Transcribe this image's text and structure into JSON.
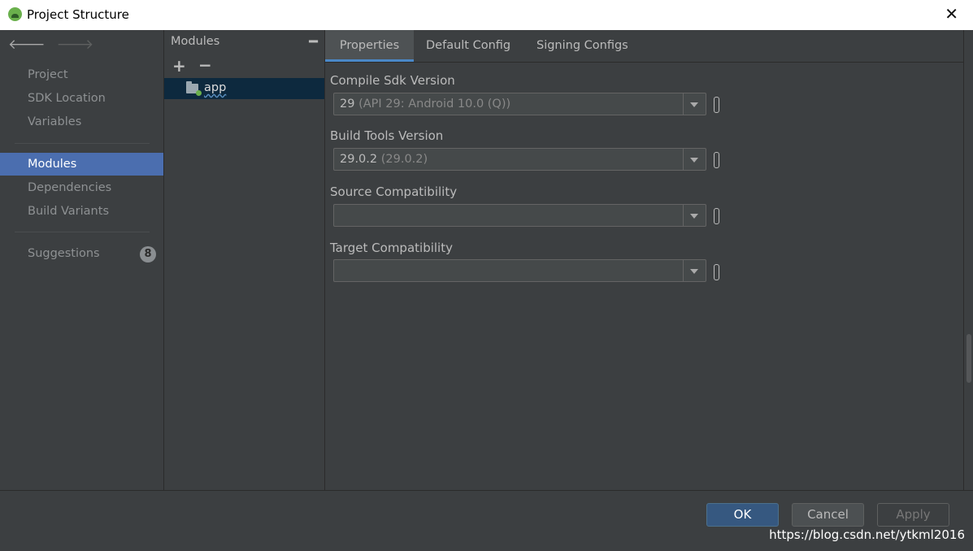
{
  "window": {
    "title": "Project Structure"
  },
  "sidebar": {
    "items": [
      {
        "label": "Project"
      },
      {
        "label": "SDK Location"
      },
      {
        "label": "Variables"
      },
      {
        "label": "Modules"
      },
      {
        "label": "Dependencies"
      },
      {
        "label": "Build Variants"
      },
      {
        "label": "Suggestions"
      }
    ],
    "active": "Modules",
    "suggestions_count": "8"
  },
  "modules_panel": {
    "title": "Modules",
    "items": [
      {
        "label": "app"
      }
    ]
  },
  "tabs": [
    {
      "label": "Properties",
      "active": true
    },
    {
      "label": "Default Config"
    },
    {
      "label": "Signing Configs"
    }
  ],
  "properties": {
    "fields": [
      {
        "label": "Compile Sdk Version",
        "value": "29",
        "hint": "(API 29: Android 10.0 (Q))"
      },
      {
        "label": "Build Tools Version",
        "value": "29.0.2",
        "hint": "(29.0.2)"
      },
      {
        "label": "Source Compatibility",
        "value": "",
        "hint": ""
      },
      {
        "label": "Target Compatibility",
        "value": "",
        "hint": ""
      }
    ]
  },
  "footer": {
    "ok": "OK",
    "cancel": "Cancel",
    "apply": "Apply",
    "watermark": "https://blog.csdn.net/ytkml2016"
  },
  "colors": {
    "background": "#3c3f41",
    "selection": "#4b6eaf",
    "tab_underline": "#4a88c7",
    "primary_button": "#365880"
  }
}
